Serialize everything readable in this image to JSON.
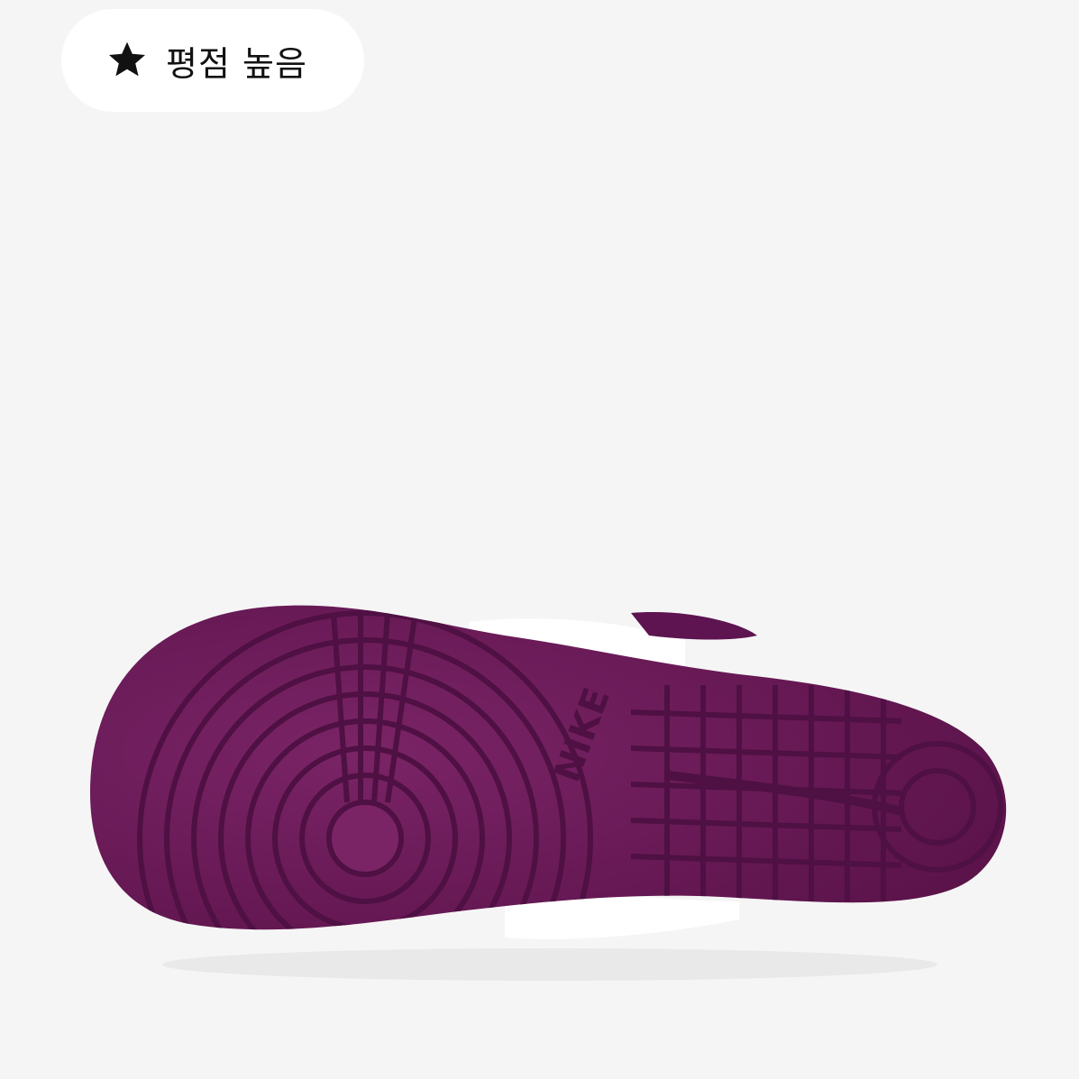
{
  "badge": {
    "label": "평점 높음",
    "icon": "star-icon"
  },
  "product_image": {
    "subject": "sneaker-outsole",
    "brand_text": "NIKE",
    "colors": {
      "background": "#f5f5f5",
      "sole": "#6e1a5c",
      "sole_dark": "#4f1043",
      "upper": "#ffffff"
    }
  }
}
